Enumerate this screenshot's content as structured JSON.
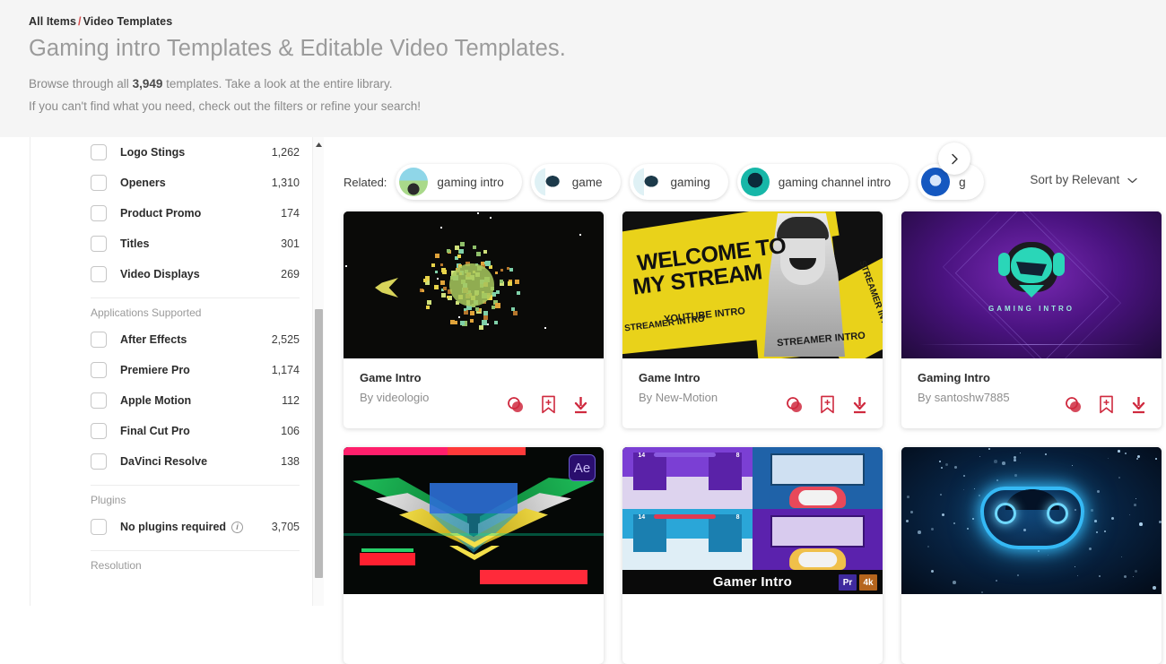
{
  "header": {
    "breadcrumb_root": "All Items",
    "breadcrumb_sep": "/",
    "breadcrumb_current": "Video Templates",
    "title": "Gaming intro Templates & Editable Video Templates.",
    "line1_pre": "Browse through all ",
    "line1_count": "3,949",
    "line1_post": " templates. Take a look at the entire library.",
    "line2": "If you can't find what you need, check out the filters or refine your search!"
  },
  "sidebar": {
    "toggle_icon": "filter-sliders-icon",
    "groups": [
      {
        "title": null,
        "items": [
          {
            "label": "Logo Stings",
            "count": "1,262"
          },
          {
            "label": "Openers",
            "count": "1,310"
          },
          {
            "label": "Product Promo",
            "count": "174"
          },
          {
            "label": "Titles",
            "count": "301"
          },
          {
            "label": "Video Displays",
            "count": "269"
          }
        ]
      },
      {
        "title": "Applications Supported",
        "items": [
          {
            "label": "After Effects",
            "count": "2,525"
          },
          {
            "label": "Premiere Pro",
            "count": "1,174"
          },
          {
            "label": "Apple Motion",
            "count": "112"
          },
          {
            "label": "Final Cut Pro",
            "count": "106"
          },
          {
            "label": "DaVinci Resolve",
            "count": "138"
          }
        ]
      },
      {
        "title": "Plugins",
        "items": [
          {
            "label": "No plugins required",
            "count": "3,705",
            "info": "i"
          }
        ]
      },
      {
        "title": "Resolution",
        "items": []
      }
    ]
  },
  "main": {
    "related_label": "Related:",
    "related_pills": [
      {
        "text": "gaming intro",
        "thumb": "landscape-thumb"
      },
      {
        "text": "game",
        "thumb": "mic-thumb"
      },
      {
        "text": "gaming",
        "thumb": "mic-thumb"
      },
      {
        "text": "gaming channel intro",
        "thumb": "teal-logo-thumb"
      },
      {
        "text": "g",
        "thumb": "blue-logo-thumb"
      }
    ],
    "next_icon": "chevron-right-icon",
    "sort_label": "Sort by Relevant",
    "sort_caret": "chevron-down-icon",
    "card_actions": [
      "similar-icon",
      "bookmark-plus-icon",
      "download-icon"
    ],
    "action_color": "#cf2a3f",
    "cards": [
      {
        "title": "Game Intro",
        "author": "By videologio",
        "art": "pixel-space"
      },
      {
        "title": "Game Intro",
        "author": "By New-Motion",
        "art": "caution-tape",
        "art_text1": "WELCOME TO",
        "art_text2": "MY STREAM",
        "art_text3": "YOUTUBE INTRO",
        "art_text4": "STREAMER INTRO"
      },
      {
        "title": "Gaming Intro",
        "author": "By santoshw7885",
        "art": "purple-mascot",
        "art_text1": "GAMING INTRO"
      },
      {
        "title": "",
        "author": "",
        "art": "glitch-wings",
        "badge": "Ae"
      },
      {
        "title": "",
        "author": "",
        "art": "gamer-quad",
        "overlay_text": "Gamer Intro",
        "badges": [
          "Pr",
          "4k"
        ]
      },
      {
        "title": "",
        "author": "",
        "art": "blue-controller"
      }
    ]
  },
  "colors": {
    "header_bg": "#f5f5f5",
    "accent_red": "#cf2a3f",
    "breadcrumb_sep": "#d64d4d",
    "caution_yellow": "#e9d21a",
    "purple": "#5b1d8c",
    "pr_badge": "#3f2a9e",
    "fourk_badge": "#b5651d"
  }
}
